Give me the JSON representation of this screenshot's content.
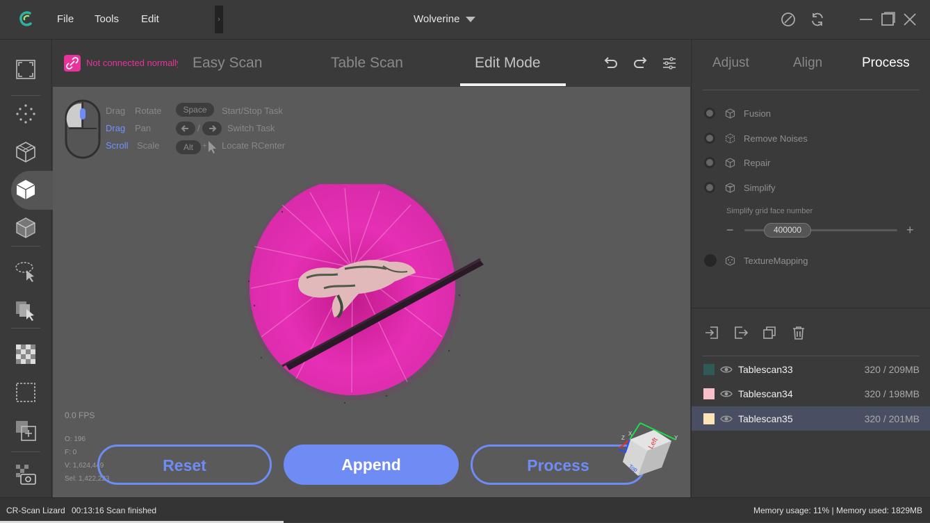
{
  "menu": {
    "file": "File",
    "tools": "Tools",
    "edit": "Edit"
  },
  "project": {
    "name": "Wolverine"
  },
  "connection": {
    "status": "Not connected normally"
  },
  "modes": {
    "easy_scan": "Easy Scan",
    "table_scan": "Table Scan",
    "edit_mode": "Edit Mode",
    "active": "Edit Mode"
  },
  "hints": {
    "drag": "Drag",
    "rotate": "Rotate",
    "drag2": "Drag",
    "pan": "Pan",
    "scroll": "Scroll",
    "scale": "Scale",
    "space_key": "Space",
    "start_stop": "Start/Stop Task",
    "slash": "/",
    "switch_task": "Switch Task",
    "alt_key": "Alt",
    "plus": "+",
    "locate": "Locate RCenter"
  },
  "viewport": {
    "fps": "0.0 FPS",
    "stats": {
      "o": "O: 196",
      "f": "F: 0",
      "v": "V: 1,624,449",
      "sel": "Sel: 1,422,223"
    },
    "axis": {
      "x": "X",
      "y": "Y",
      "z": "Z",
      "face_left": "Left",
      "face_top": "Top"
    }
  },
  "buttons": {
    "reset": "Reset",
    "append": "Append",
    "process": "Process"
  },
  "right_panel": {
    "tabs": {
      "adjust": "Adjust",
      "align": "Align",
      "process": "Process"
    },
    "steps": [
      {
        "label": "Fusion",
        "icon": "cube-icon"
      },
      {
        "label": "Remove Noises",
        "icon": "noise-cube-icon"
      },
      {
        "label": "Repair",
        "icon": "repair-cube-icon"
      },
      {
        "label": "Simplify",
        "icon": "simplify-cube-icon"
      }
    ],
    "simplify": {
      "label": "Simplify grid face number",
      "value": "400000",
      "minus": "−",
      "plus": "+"
    },
    "texture": {
      "label": "TextureMapping",
      "icon": "texture-icon"
    },
    "scans": [
      {
        "name": "Tablescan33",
        "size": "320 / 209MB",
        "color": "#2f5a58"
      },
      {
        "name": "Tablescan34",
        "size": "320 / 198MB",
        "color": "#f7c0c9"
      },
      {
        "name": "Tablescan35",
        "size": "320 / 201MB",
        "color": "#fce3b8"
      }
    ]
  },
  "status": {
    "device": "CR-Scan Lizard",
    "message": "00:13:16 Scan finished",
    "memory": "Memory usage: 11% | Memory used: 1829MB"
  },
  "colors": {
    "accent": "#6f8cf5",
    "connection": "#e8339a",
    "model_pink": "#e62fb5"
  }
}
